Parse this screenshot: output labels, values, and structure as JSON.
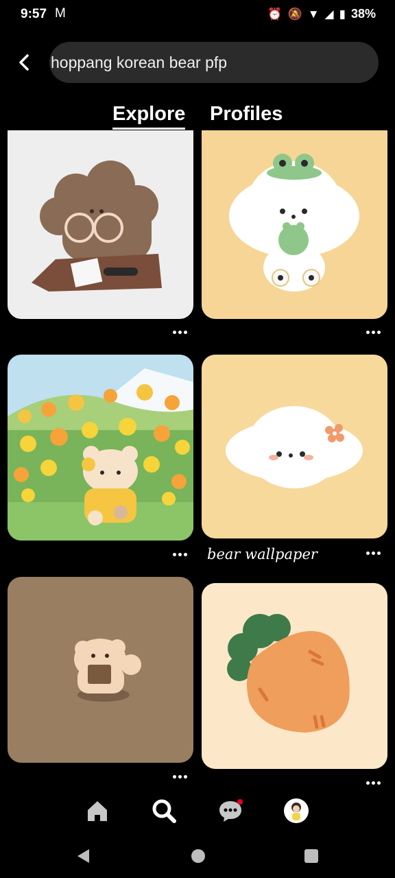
{
  "status": {
    "time": "9:57",
    "battery": "38%"
  },
  "search": {
    "query": "hoppang korean bear pfp"
  },
  "tabs": [
    {
      "label": "Explore",
      "active": true
    },
    {
      "label": "Profiles",
      "active": false
    }
  ],
  "pins": [
    {
      "caption": ""
    },
    {
      "caption": ""
    },
    {
      "caption": ""
    },
    {
      "caption": "bear wallpaper"
    },
    {
      "caption": ""
    },
    {
      "caption": ""
    }
  ],
  "nav": {
    "items": [
      "home-icon",
      "search-icon",
      "messages-icon",
      "profile-avatar"
    ],
    "active": "search-icon",
    "notification_color": "#e60023"
  },
  "colors": {
    "background": "#000000",
    "search_bg": "#2b2b2b"
  }
}
